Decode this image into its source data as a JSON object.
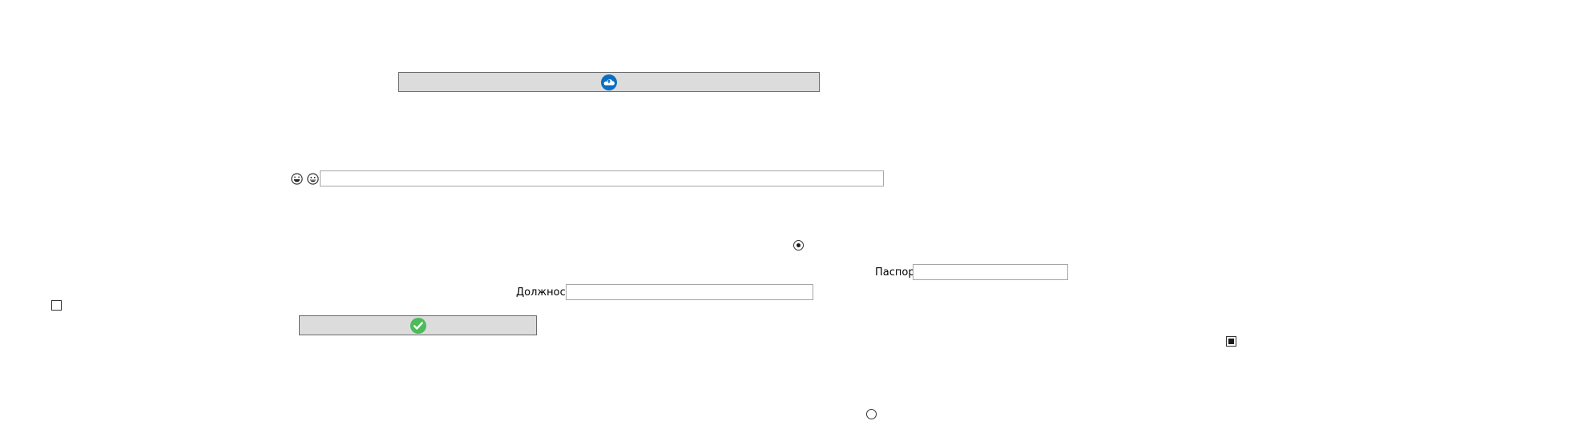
{
  "form": {
    "top_button": {
      "icon": "cloud-upload-icon"
    },
    "emoji_row": {
      "icons": [
        "laughing-face-icon",
        "smiling-face-icon"
      ],
      "input_value": ""
    },
    "passport_field": {
      "label": "Паспорт",
      "value": ""
    },
    "position_field": {
      "label": "Должность",
      "value": ""
    },
    "confirm_button": {
      "icon": "check-circle-icon"
    },
    "radio_top": {
      "checked": true
    },
    "radio_bottom": {
      "checked": false
    },
    "checkbox_left": {
      "checked": false
    },
    "checkbox_right": {
      "state": "indeterminate"
    }
  },
  "colors": {
    "button_face": "#dcdcdc",
    "button_border": "#6b6b6b",
    "cloud_icon_blue": "#0a6fc2",
    "check_icon_green": "#4cbb5a",
    "input_border": "#a6a6a6"
  }
}
